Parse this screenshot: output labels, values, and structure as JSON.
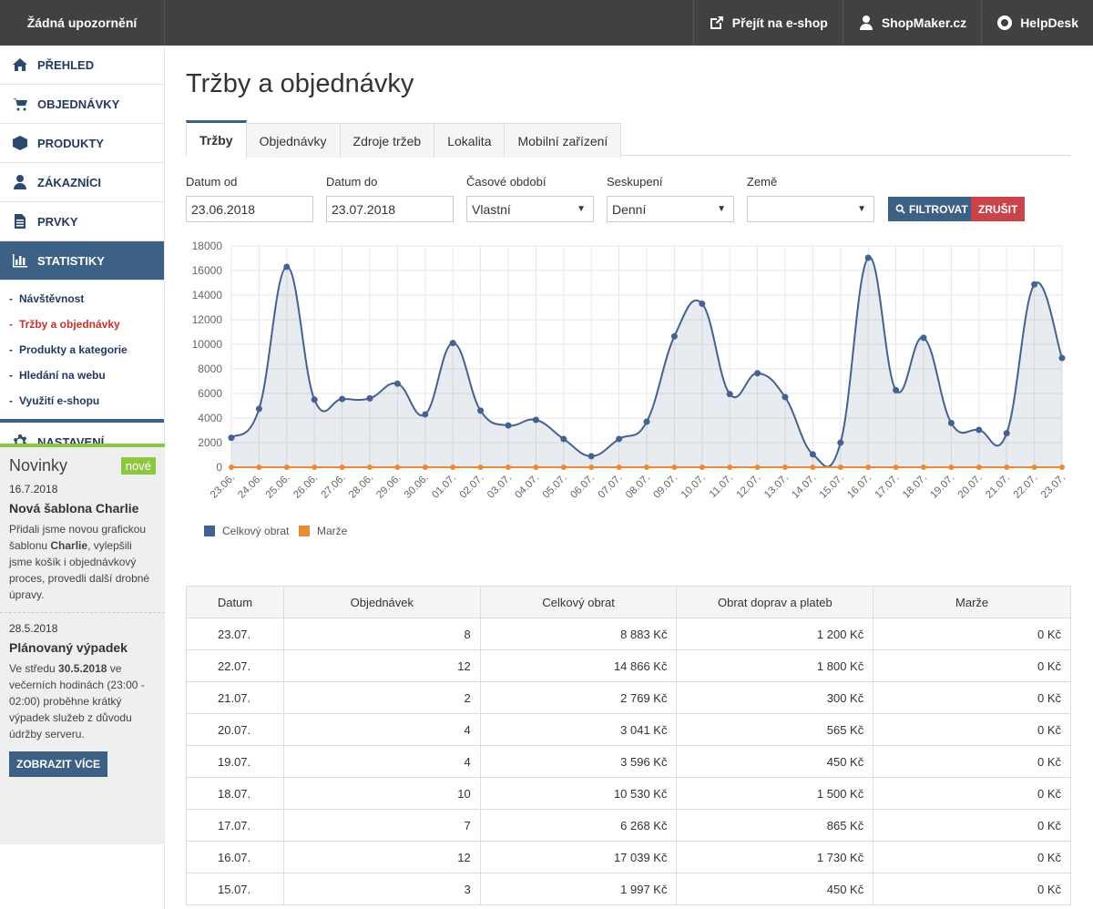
{
  "topbar": {
    "notifications": "Žádná upozornění",
    "links": [
      {
        "label": "Přejít na e-shop",
        "icon": "external-link-icon"
      },
      {
        "label": "ShopMaker.cz",
        "icon": "user-icon"
      },
      {
        "label": "HelpDesk",
        "icon": "lifebuoy-icon"
      }
    ]
  },
  "sidebar": {
    "items": [
      {
        "label": "PŘEHLED",
        "icon": "home-icon"
      },
      {
        "label": "OBJEDNÁVKY",
        "icon": "cart-icon"
      },
      {
        "label": "PRODUKTY",
        "icon": "box-icon"
      },
      {
        "label": "ZÁKAZNÍCI",
        "icon": "user-icon"
      },
      {
        "label": "PRVKY",
        "icon": "file-icon"
      },
      {
        "label": "STATISTIKY",
        "icon": "bar-chart-icon"
      },
      {
        "label": "NASTAVENÍ",
        "icon": "gear-icon"
      }
    ],
    "subitems": [
      {
        "label": "Návštěvnost"
      },
      {
        "label": "Tržby a objednávky"
      },
      {
        "label": "Produkty a kategorie"
      },
      {
        "label": "Hledání na webu"
      },
      {
        "label": "Využití e-shopu"
      }
    ]
  },
  "news": {
    "title": "Novinky",
    "badge": "nové",
    "items": [
      {
        "date": "16.7.2018",
        "heading": "Nová šablona Charlie",
        "text_before": "Přidali jsme novou grafickou šablonu ",
        "text_bold": "Charlie",
        "text_after": ", vylepšili jsme košík i objednávkový proces, provedli další drobné úpravy."
      },
      {
        "date": "28.5.2018",
        "heading": "Plánovaný výpadek",
        "text_before": "Ve středu ",
        "text_bold": "30.5.2018",
        "text_after": " ve večerních hodinách (23:00 - 02:00) proběhne krátký výpadek služeb z důvodu údržby serveru."
      }
    ],
    "more_button": "ZOBRAZIT VÍCE"
  },
  "main": {
    "title": "Tržby a objednávky",
    "tabs": [
      "Tržby",
      "Objednávky",
      "Zdroje tržeb",
      "Lokalita",
      "Mobilní zařízení"
    ],
    "filters": {
      "date_from_label": "Datum od",
      "date_from_value": "23.06.2018",
      "date_to_label": "Datum do",
      "date_to_value": "23.07.2018",
      "period_label": "Časové období",
      "period_value": "Vlastní",
      "group_label": "Seskupení",
      "group_value": "Denní",
      "country_label": "Země",
      "country_value": "",
      "filter_button": "FILTROVAT",
      "cancel_button": "ZRUŠIT"
    }
  },
  "colors": {
    "series1": "#44618f",
    "series2": "#e98b34",
    "accent": "#3d6185",
    "danger": "#c9444a",
    "news_accent": "#8dc63f"
  },
  "chart_data": {
    "type": "area",
    "x": [
      "23.06.",
      "24.06.",
      "25.06.",
      "26.06.",
      "27.06.",
      "28.06.",
      "29.06.",
      "30.06.",
      "01.07.",
      "02.07.",
      "03.07.",
      "04.07.",
      "05.07.",
      "06.07.",
      "07.07.",
      "08.07.",
      "09.07.",
      "10.07.",
      "11.07.",
      "12.07.",
      "13.07.",
      "14.07.",
      "15.07.",
      "16.07.",
      "17.07.",
      "18.07.",
      "19.07.",
      "20.07.",
      "21.07.",
      "22.07.",
      "23.07."
    ],
    "series": [
      {
        "name": "Celkový obrat",
        "values": [
          2400,
          4750,
          16300,
          5500,
          5550,
          5600,
          6800,
          4300,
          10100,
          4600,
          3400,
          3850,
          2300,
          900,
          2300,
          3700,
          10650,
          13300,
          5950,
          7650,
          5700,
          1050,
          1997,
          17039,
          6268,
          10530,
          3596,
          3041,
          2769,
          14866,
          8883
        ]
      },
      {
        "name": "Marže",
        "values": [
          0,
          0,
          0,
          0,
          0,
          0,
          0,
          0,
          0,
          0,
          0,
          0,
          0,
          0,
          0,
          0,
          0,
          0,
          0,
          0,
          0,
          0,
          0,
          0,
          0,
          0,
          0,
          0,
          0,
          0,
          0
        ]
      }
    ],
    "ylim": [
      0,
      18000
    ],
    "yticks": [
      "0",
      "2000",
      "4000",
      "6000",
      "8000",
      "10000",
      "12000",
      "14000",
      "16000",
      "18000"
    ],
    "grid": true,
    "legend": "bottom-left"
  },
  "table": {
    "headers": [
      "Datum",
      "Objednávek",
      "Celkový obrat",
      "Obrat doprav a plateb",
      "Marže"
    ],
    "rows": [
      [
        "23.07.",
        "8",
        "8 883 Kč",
        "1 200 Kč",
        "0 Kč"
      ],
      [
        "22.07.",
        "12",
        "14 866 Kč",
        "1 800 Kč",
        "0 Kč"
      ],
      [
        "21.07.",
        "2",
        "2 769 Kč",
        "300 Kč",
        "0 Kč"
      ],
      [
        "20.07.",
        "4",
        "3 041 Kč",
        "565 Kč",
        "0 Kč"
      ],
      [
        "19.07.",
        "4",
        "3 596 Kč",
        "450 Kč",
        "0 Kč"
      ],
      [
        "18.07.",
        "10",
        "10 530 Kč",
        "1 500 Kč",
        "0 Kč"
      ],
      [
        "17.07.",
        "7",
        "6 268 Kč",
        "865 Kč",
        "0 Kč"
      ],
      [
        "16.07.",
        "12",
        "17 039 Kč",
        "1 730 Kč",
        "0 Kč"
      ],
      [
        "15.07.",
        "3",
        "1 997 Kč",
        "450 Kč",
        "0 Kč"
      ]
    ]
  }
}
